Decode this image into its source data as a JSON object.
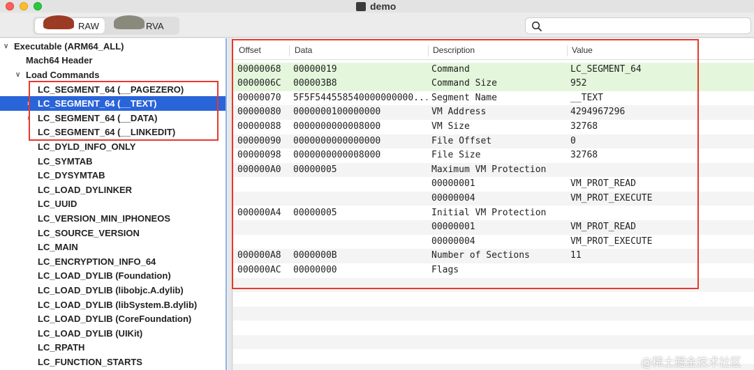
{
  "window": {
    "title": "demo"
  },
  "toolbar": {
    "modes": [
      {
        "label": "RAW"
      },
      {
        "label": "RVA"
      }
    ],
    "search_placeholder": ""
  },
  "sidebar": {
    "items": [
      {
        "label": "Executable  (ARM64_ALL)",
        "indent": 0,
        "disclosure": "open"
      },
      {
        "label": "Mach64 Header",
        "indent": 1,
        "disclosure": "none"
      },
      {
        "label": "Load Commands",
        "indent": 1,
        "disclosure": "open"
      },
      {
        "label": "LC_SEGMENT_64 (__PAGEZERO)",
        "indent": 2,
        "disclosure": "none"
      },
      {
        "label": "LC_SEGMENT_64 (__TEXT)",
        "indent": 2,
        "disclosure": "closed",
        "selected": true
      },
      {
        "label": "LC_SEGMENT_64 (__DATA)",
        "indent": 2,
        "disclosure": "closed"
      },
      {
        "label": "LC_SEGMENT_64 (__LINKEDIT)",
        "indent": 2,
        "disclosure": "none"
      },
      {
        "label": "LC_DYLD_INFO_ONLY",
        "indent": 2,
        "disclosure": "none"
      },
      {
        "label": "LC_SYMTAB",
        "indent": 2,
        "disclosure": "none"
      },
      {
        "label": "LC_DYSYMTAB",
        "indent": 2,
        "disclosure": "none"
      },
      {
        "label": "LC_LOAD_DYLINKER",
        "indent": 2,
        "disclosure": "none"
      },
      {
        "label": "LC_UUID",
        "indent": 2,
        "disclosure": "none"
      },
      {
        "label": "LC_VERSION_MIN_IPHONEOS",
        "indent": 2,
        "disclosure": "none"
      },
      {
        "label": "LC_SOURCE_VERSION",
        "indent": 2,
        "disclosure": "none"
      },
      {
        "label": "LC_MAIN",
        "indent": 2,
        "disclosure": "none"
      },
      {
        "label": "LC_ENCRYPTION_INFO_64",
        "indent": 2,
        "disclosure": "none"
      },
      {
        "label": "LC_LOAD_DYLIB (Foundation)",
        "indent": 2,
        "disclosure": "none"
      },
      {
        "label": "LC_LOAD_DYLIB (libobjc.A.dylib)",
        "indent": 2,
        "disclosure": "none"
      },
      {
        "label": "LC_LOAD_DYLIB (libSystem.B.dylib)",
        "indent": 2,
        "disclosure": "none"
      },
      {
        "label": "LC_LOAD_DYLIB (CoreFoundation)",
        "indent": 2,
        "disclosure": "none"
      },
      {
        "label": "LC_LOAD_DYLIB (UIKit)",
        "indent": 2,
        "disclosure": "none"
      },
      {
        "label": "LC_RPATH",
        "indent": 2,
        "disclosure": "none"
      },
      {
        "label": "LC_FUNCTION_STARTS",
        "indent": 2,
        "disclosure": "none"
      }
    ]
  },
  "table": {
    "columns": [
      "Offset",
      "Data",
      "Description",
      "Value"
    ],
    "rows": [
      {
        "offset": "00000068",
        "data": "00000019",
        "description": "Command",
        "value": "LC_SEGMENT_64",
        "highlight": true
      },
      {
        "offset": "0000006C",
        "data": "000003B8",
        "description": "Command Size",
        "value": "952",
        "highlight": true
      },
      {
        "offset": "00000070",
        "data": "5F5F544558540000000000...",
        "description": "Segment Name",
        "value": "__TEXT"
      },
      {
        "offset": "00000080",
        "data": "0000000100000000",
        "description": "VM Address",
        "value": "4294967296"
      },
      {
        "offset": "00000088",
        "data": "0000000000008000",
        "description": "VM Size",
        "value": "32768"
      },
      {
        "offset": "00000090",
        "data": "0000000000000000",
        "description": "File Offset",
        "value": "0"
      },
      {
        "offset": "00000098",
        "data": "0000000000008000",
        "description": "File Size",
        "value": "32768"
      },
      {
        "offset": "000000A0",
        "data": "00000005",
        "description": "Maximum VM Protection",
        "value": ""
      },
      {
        "offset": "",
        "data": "",
        "description": "00000001",
        "value": "VM_PROT_READ"
      },
      {
        "offset": "",
        "data": "",
        "description": "00000004",
        "value": "VM_PROT_EXECUTE"
      },
      {
        "offset": "000000A4",
        "data": "00000005",
        "description": "Initial VM Protection",
        "value": ""
      },
      {
        "offset": "",
        "data": "",
        "description": "00000001",
        "value": "VM_PROT_READ"
      },
      {
        "offset": "",
        "data": "",
        "description": "00000004",
        "value": "VM_PROT_EXECUTE"
      },
      {
        "offset": "000000A8",
        "data": "0000000B",
        "description": "Number of Sections",
        "value": "11"
      },
      {
        "offset": "000000AC",
        "data": "00000000",
        "description": "Flags",
        "value": ""
      }
    ]
  },
  "watermark": "@稀土掘金技术社区"
}
